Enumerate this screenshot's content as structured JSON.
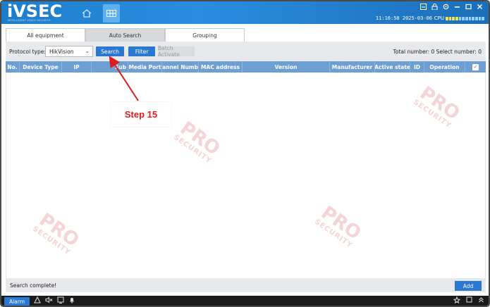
{
  "app": {
    "logo": "iVSEC",
    "logo_sub": "INTELLIGENT VIDEO SECURITY"
  },
  "titlebar": {
    "clock": "11:16:58 2025-03-06",
    "cpu_label": "CPU",
    "cpu_level": 0.35,
    "nav_icons": [
      "home-icon",
      "grid-icon"
    ],
    "window_icons": [
      "save-icon",
      "lock-icon",
      "settings-icon",
      "minimize-icon",
      "close-icon"
    ]
  },
  "tabs": [
    {
      "label": "All equipment",
      "active": false
    },
    {
      "label": "Auto Search",
      "active": true
    },
    {
      "label": "Grouping",
      "active": false
    }
  ],
  "toolbar": {
    "protocol_label": "Protocol type:",
    "protocol_value": "HikVision",
    "search_label": "Search",
    "filter_label": "Filter",
    "batch_label": "Batch Activate",
    "totals": "Total number: 0   Select number: 0"
  },
  "table": {
    "columns": [
      "No.",
      "Device Type",
      "IP",
      "Sub",
      "Media Port",
      "Channel Numb",
      "MAC address",
      "Version",
      "Manufacturer",
      "Active state",
      "ID",
      "Operation"
    ],
    "rows": []
  },
  "watermark": {
    "big": "PRO",
    "small": "SECURITY"
  },
  "status": {
    "text": "Search complete!",
    "add_label": "Add"
  },
  "bottombar": {
    "alarm_label": "Alarm"
  },
  "annotation": {
    "label": "Step 15",
    "color": "#e01b1b"
  },
  "colors": {
    "titlebar": "#1d7dc9",
    "button": "#2b78d2",
    "table_header": "#6d9fd3"
  }
}
